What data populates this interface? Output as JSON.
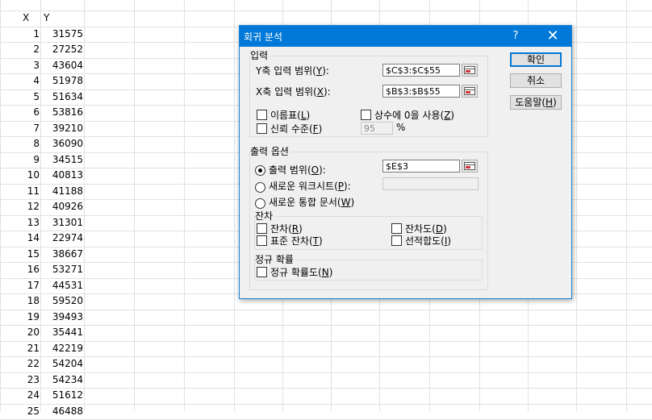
{
  "sheet": {
    "header_x": "X",
    "header_y": "Y",
    "rows": [
      {
        "x": "1",
        "y": "31575"
      },
      {
        "x": "2",
        "y": "27252"
      },
      {
        "x": "3",
        "y": "43604"
      },
      {
        "x": "4",
        "y": "51978"
      },
      {
        "x": "5",
        "y": "51634"
      },
      {
        "x": "6",
        "y": "53816"
      },
      {
        "x": "7",
        "y": "39210"
      },
      {
        "x": "8",
        "y": "36090"
      },
      {
        "x": "9",
        "y": "34515"
      },
      {
        "x": "10",
        "y": "40813"
      },
      {
        "x": "11",
        "y": "41188"
      },
      {
        "x": "12",
        "y": "40926"
      },
      {
        "x": "13",
        "y": "31301"
      },
      {
        "x": "14",
        "y": "22974"
      },
      {
        "x": "15",
        "y": "38667"
      },
      {
        "x": "16",
        "y": "53271"
      },
      {
        "x": "17",
        "y": "44531"
      },
      {
        "x": "18",
        "y": "59520"
      },
      {
        "x": "19",
        "y": "39493"
      },
      {
        "x": "20",
        "y": "35441"
      },
      {
        "x": "21",
        "y": "42219"
      },
      {
        "x": "22",
        "y": "54204"
      },
      {
        "x": "23",
        "y": "54234"
      },
      {
        "x": "24",
        "y": "51612"
      },
      {
        "x": "25",
        "y": "46488"
      }
    ]
  },
  "dialog": {
    "title": "회귀 분석",
    "help_label": "?",
    "close_label": "✕",
    "input_group": {
      "label": "입력",
      "y_range_label": "Y축 입력 범위(",
      "y_range_key": "Y",
      "y_range_value": "$C$3:$C$55",
      "x_range_label": "X축 입력 범위(",
      "x_range_key": "X",
      "x_range_value": "$B$3:$B$55",
      "labels_text": "이름표(",
      "labels_key": "L",
      "constant_zero_text": "상수에 0을 사용(",
      "constant_zero_key": "Z",
      "confidence_text": "신뢰 수준(",
      "confidence_key": "F",
      "confidence_value": "95",
      "percent": "%"
    },
    "output_group": {
      "label": "출력 옵션",
      "output_range_text": "출력 범위(",
      "output_range_key": "O",
      "output_range_value": "$E$3",
      "new_sheet_text": "새로운 워크시트(",
      "new_sheet_key": "P",
      "new_workbook_text": "새로운 통합 문서(",
      "new_workbook_key": "W",
      "residuals_label": "잔차",
      "residuals_text": "잔차(",
      "residuals_key": "R",
      "residual_plots_text": "잔차도(",
      "residual_plots_key": "D",
      "std_residuals_text": "표준 잔차(",
      "std_residuals_key": "T",
      "line_fit_text": "선적합도(",
      "line_fit_key": "I",
      "normal_label": "정규 확률",
      "normal_plots_text": "정규 확률도(",
      "normal_plots_key": "N"
    },
    "buttons": {
      "ok": "확인",
      "cancel": "취소",
      "help_text": "도움말(",
      "help_key": "H"
    },
    "close_paren": ")",
    "colon_suffix": "):"
  }
}
